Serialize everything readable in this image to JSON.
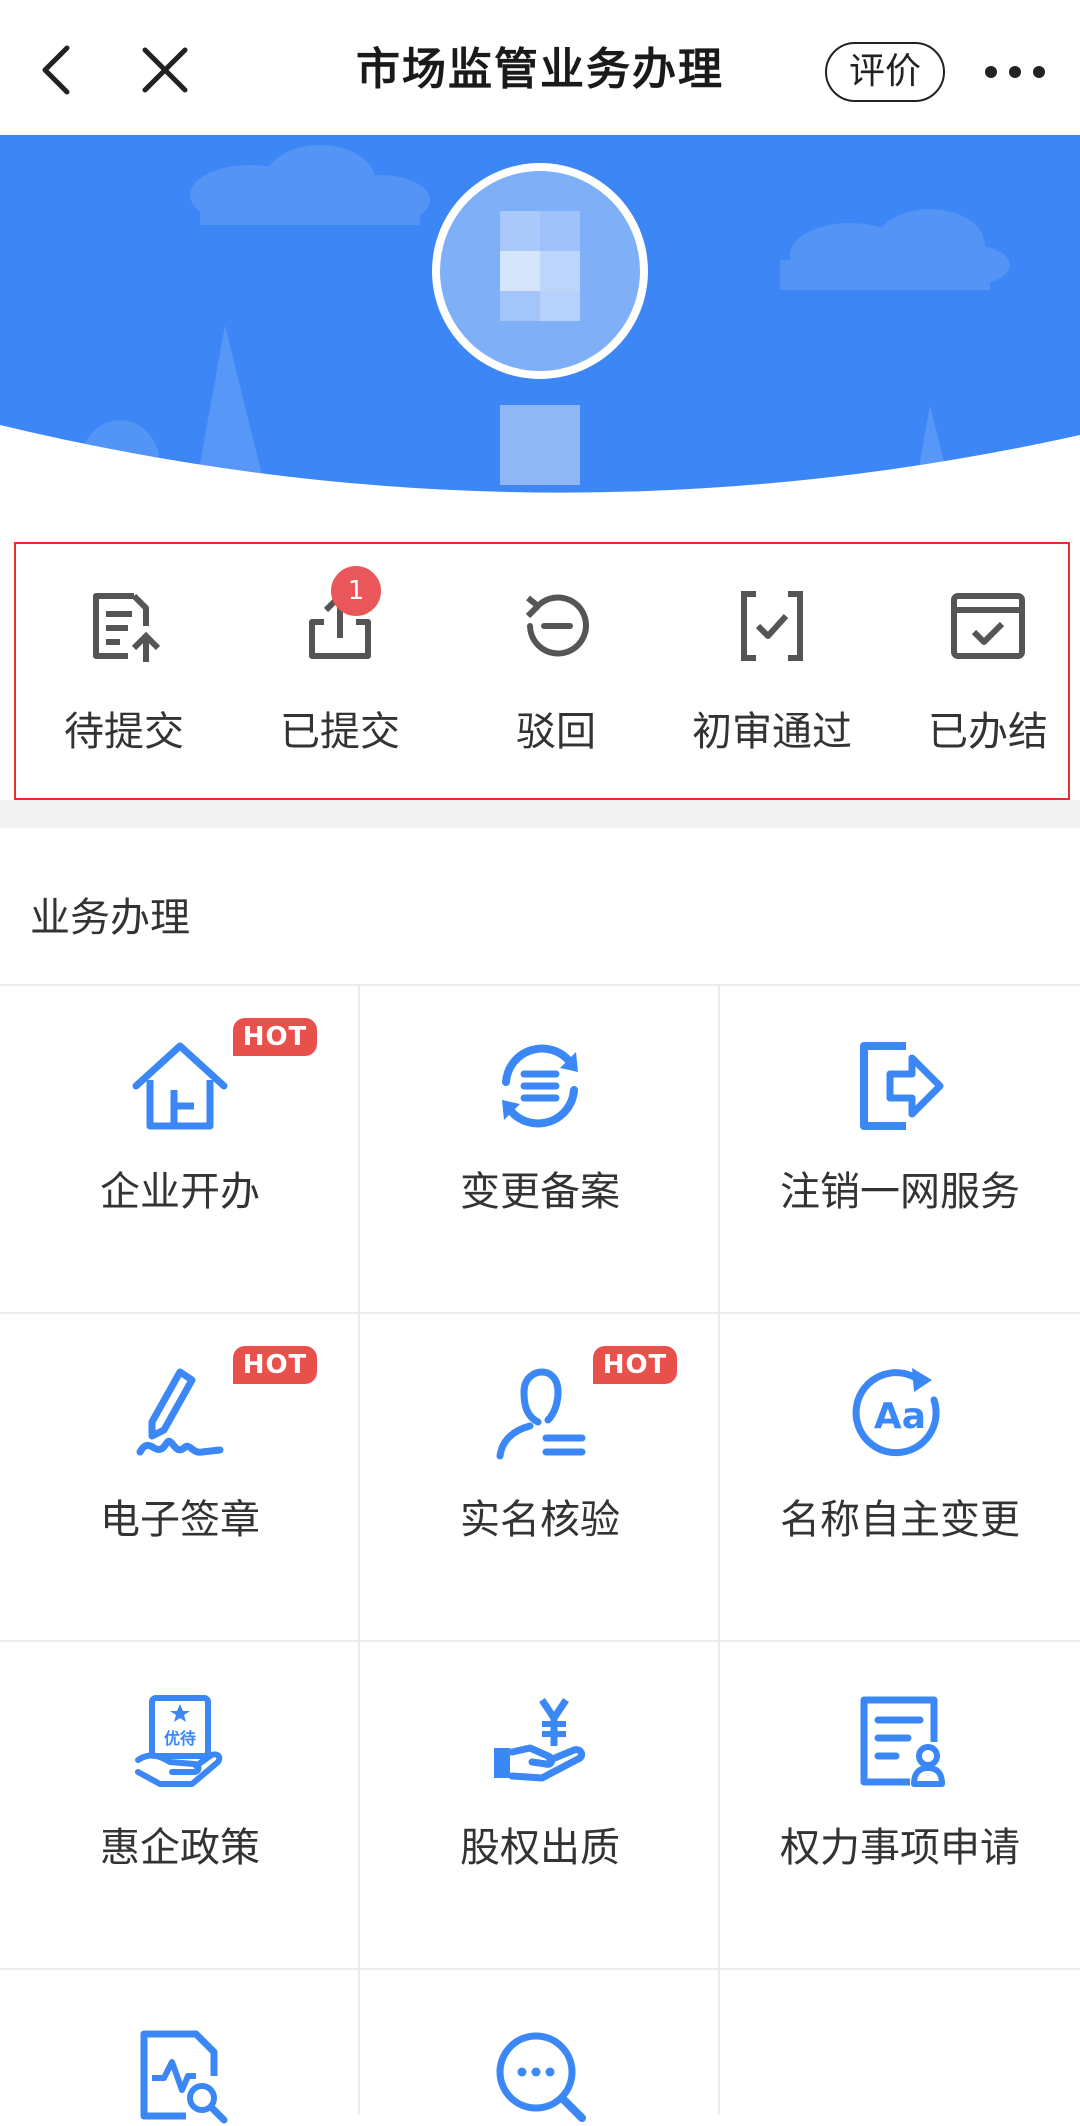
{
  "nav": {
    "title": "市场监管业务办理",
    "rate_label": "评价"
  },
  "status": {
    "items": [
      {
        "label": "待提交",
        "icon": "document-upload-icon"
      },
      {
        "label": "已提交",
        "icon": "share-upload-icon",
        "badge": "1"
      },
      {
        "label": "驳回",
        "icon": "undo-circle-icon"
      },
      {
        "label": "初审通过",
        "icon": "bracket-check-icon"
      },
      {
        "label": "已办结",
        "icon": "calendar-check-icon"
      }
    ]
  },
  "section": {
    "title": "业务办理"
  },
  "services": [
    {
      "label": "企业开办",
      "icon": "house-icon",
      "hot": "HOT"
    },
    {
      "label": "变更备案",
      "icon": "refresh-list-icon"
    },
    {
      "label": "注销一网服务",
      "icon": "logout-icon"
    },
    {
      "label": "电子签章",
      "icon": "pen-signature-icon",
      "hot": "HOT"
    },
    {
      "label": "实名核验",
      "icon": "person-verify-icon",
      "hot": "HOT"
    },
    {
      "label": "名称自主变更",
      "icon": "aa-rotate-icon"
    },
    {
      "label": "惠企政策",
      "icon": "hand-card-icon",
      "card_text": "优待"
    },
    {
      "label": "股权出质",
      "icon": "hand-yen-icon"
    },
    {
      "label": "权力事项申请",
      "icon": "document-person-icon"
    }
  ],
  "colors": {
    "accent": "#3a87f5",
    "banner": "#3d86f5",
    "hot": "#e8514b",
    "badge": "#e9575a",
    "highlight_border": "#e7302a"
  }
}
